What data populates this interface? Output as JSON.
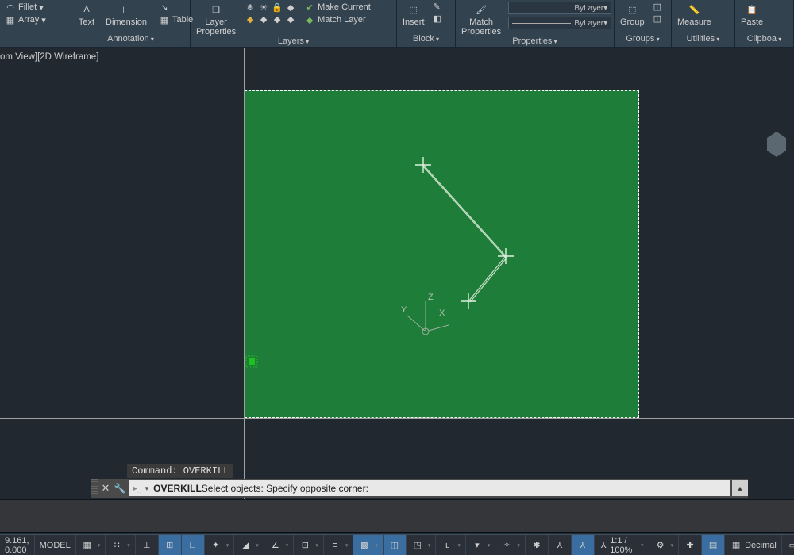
{
  "ribbon": {
    "panels": {
      "modify": {
        "fillet": "Fillet",
        "array": "Array"
      },
      "annotation": {
        "label": "Annotation",
        "text": "Text",
        "dimension": "Dimension",
        "table": "Table"
      },
      "layers": {
        "label": "Layers",
        "layer_properties": "Layer\nProperties",
        "make_current": "Make Current",
        "match_layer": "Match Layer"
      },
      "block": {
        "label": "Block",
        "insert": "Insert"
      },
      "properties": {
        "label": "Properties",
        "match": "Match\nProperties",
        "sel1": "ByLayer",
        "sel2": "ByLayer"
      },
      "groups": {
        "label": "Groups",
        "group": "Group"
      },
      "utilities": {
        "label": "Utilities",
        "measure": "Measure"
      },
      "clipboard": {
        "label": "Clipboa",
        "paste": "Paste"
      }
    }
  },
  "viewport": {
    "label": "om View][2D Wireframe]",
    "ucs": {
      "x": "X",
      "y": "Y",
      "z": "Z"
    }
  },
  "command": {
    "history": "Command: OVERKILL",
    "active": "OVERKILL",
    "prompt_tail": " Select objects: Specify opposite corner:"
  },
  "status": {
    "coords": "9.161, 0.000",
    "model": "MODEL",
    "scale": "1:1 / 100%",
    "decimal": "Decimal"
  }
}
